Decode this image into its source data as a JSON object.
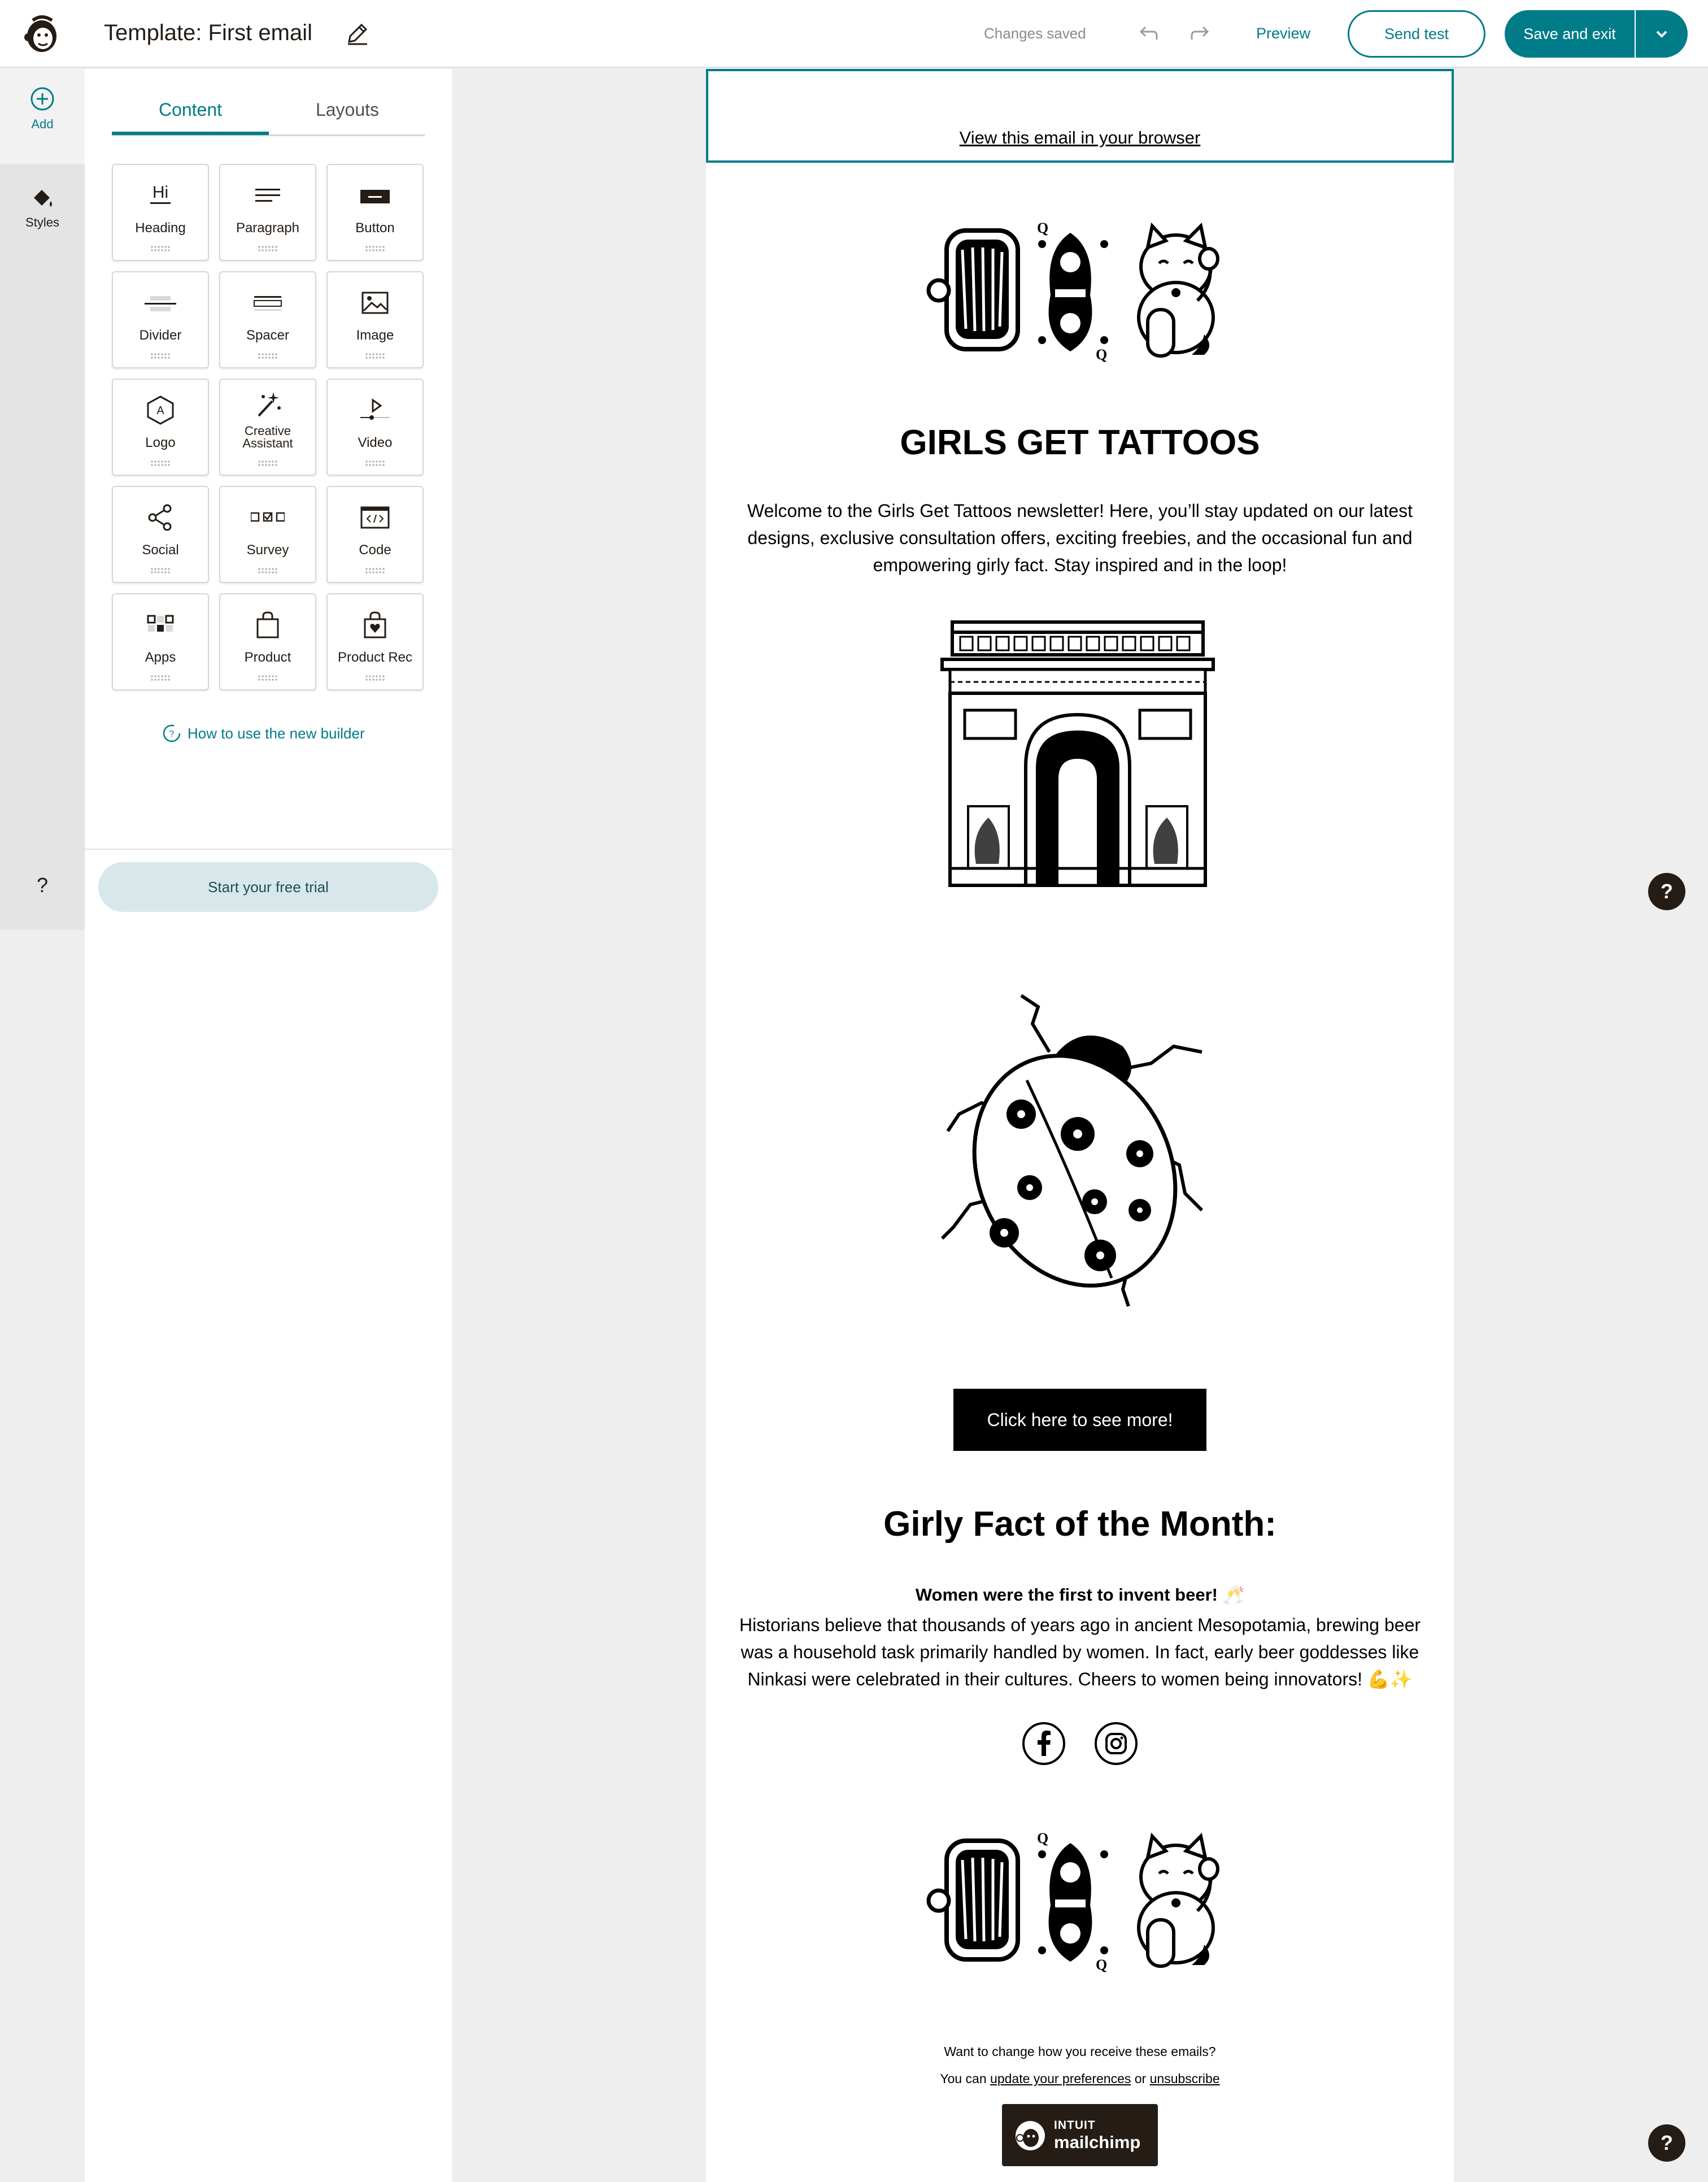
{
  "header": {
    "title": "Template: First email",
    "status": "Changes saved",
    "preview_label": "Preview",
    "send_test_label": "Send test",
    "save_exit_label": "Save and exit"
  },
  "rail": {
    "add_label": "Add",
    "styles_label": "Styles",
    "help_label": "?"
  },
  "panel": {
    "tabs": [
      {
        "label": "Content"
      },
      {
        "label": "Layouts"
      }
    ],
    "blocks": [
      {
        "label": "Heading",
        "icon": "heading-icon"
      },
      {
        "label": "Paragraph",
        "icon": "paragraph-icon"
      },
      {
        "label": "Button",
        "icon": "button-icon"
      },
      {
        "label": "Divider",
        "icon": "divider-icon"
      },
      {
        "label": "Spacer",
        "icon": "spacer-icon"
      },
      {
        "label": "Image",
        "icon": "image-icon"
      },
      {
        "label": "Logo",
        "icon": "logo-icon"
      },
      {
        "label": "Creative Assistant",
        "icon": "magic-wand-icon"
      },
      {
        "label": "Video",
        "icon": "video-icon"
      },
      {
        "label": "Social",
        "icon": "share-icon"
      },
      {
        "label": "Survey",
        "icon": "survey-icon"
      },
      {
        "label": "Code",
        "icon": "code-icon"
      },
      {
        "label": "Apps",
        "icon": "apps-icon"
      },
      {
        "label": "Product",
        "icon": "shopping-bag-icon"
      },
      {
        "label": "Product Rec",
        "icon": "product-rec-icon"
      }
    ],
    "heading_icon_text": "Hi",
    "logo_icon_text": "A",
    "howto_label": "How to use the new builder",
    "trial_label": "Start your free trial"
  },
  "email": {
    "view_in_browser": "View this email in your browser",
    "title": "GIRLS GET TATTOOS",
    "intro": "Welcome to the Girls Get Tattoos newsletter! Here, you’ll stay updated on our latest designs, exclusive consultation offers, exciting freebies, and the occasional fun and empowering girly fact. Stay inspired and in the loop!",
    "cta_label": "Click here to see more!",
    "fact_heading": "Girly Fact of the Month:",
    "fact_title": "Women were the first to invent beer! 🥂",
    "fact_body": "Historians believe that thousands of years ago in ancient Mesopotamia, brewing beer was a household task primarily handled by women. In fact, early beer goddesses like Ninkasi were celebrated in their cultures. Cheers to women being innovators! 💪✨",
    "social_icons": [
      "facebook-icon",
      "instagram-icon"
    ],
    "footer_line1": "Want to change how you receive these emails?",
    "footer_prefix": "You can ",
    "footer_link1": "update your preferences",
    "footer_mid": " or ",
    "footer_link2": "unsubscribe",
    "badge_line1": "INTUIT",
    "badge_line2": "mailchimp"
  },
  "floating": {
    "help_label": "?"
  },
  "colors": {
    "accent": "#007c89",
    "brand_dark": "#241c15",
    "trial_bg": "#d8e8ea"
  }
}
